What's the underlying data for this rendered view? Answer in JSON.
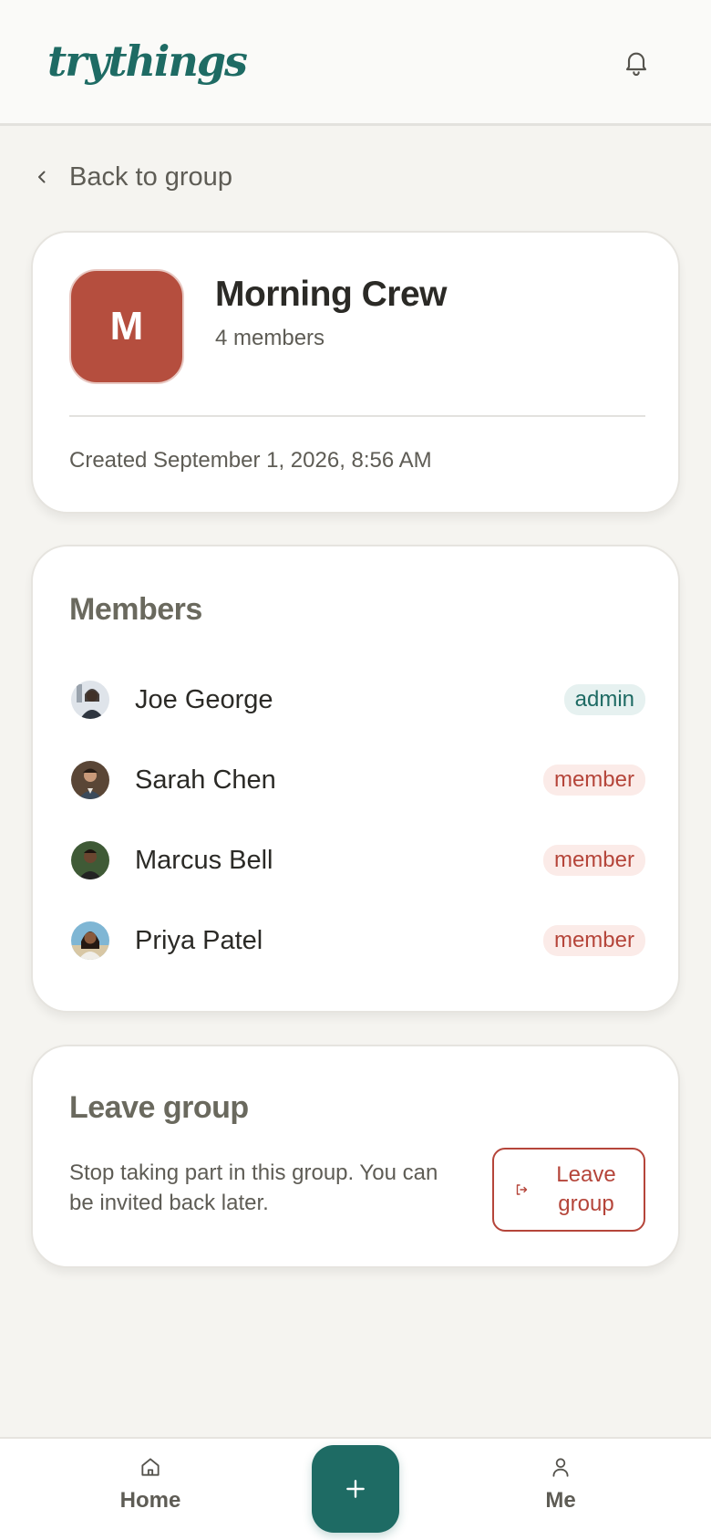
{
  "app": {
    "logo": "trythings"
  },
  "nav": {
    "back_label": "Back to group"
  },
  "group": {
    "initial": "M",
    "name": "Morning Crew",
    "member_count": "4 members",
    "created": "Created September 1, 2026, 8:56 AM",
    "avatar_color": "#b54e3e"
  },
  "members": {
    "title": "Members",
    "items": [
      {
        "name": "Joe George",
        "role": "admin"
      },
      {
        "name": "Sarah Chen",
        "role": "member"
      },
      {
        "name": "Marcus Bell",
        "role": "member"
      },
      {
        "name": "Priya Patel",
        "role": "member"
      }
    ]
  },
  "leave": {
    "title": "Leave group",
    "description": "Stop taking part in this group. You can be invited back later.",
    "button_label": "Leave group"
  },
  "bottom_nav": {
    "home_label": "Home",
    "me_label": "Me"
  },
  "colors": {
    "brand": "#1e6b64",
    "danger": "#b5453a",
    "background": "#f5f4f0"
  }
}
